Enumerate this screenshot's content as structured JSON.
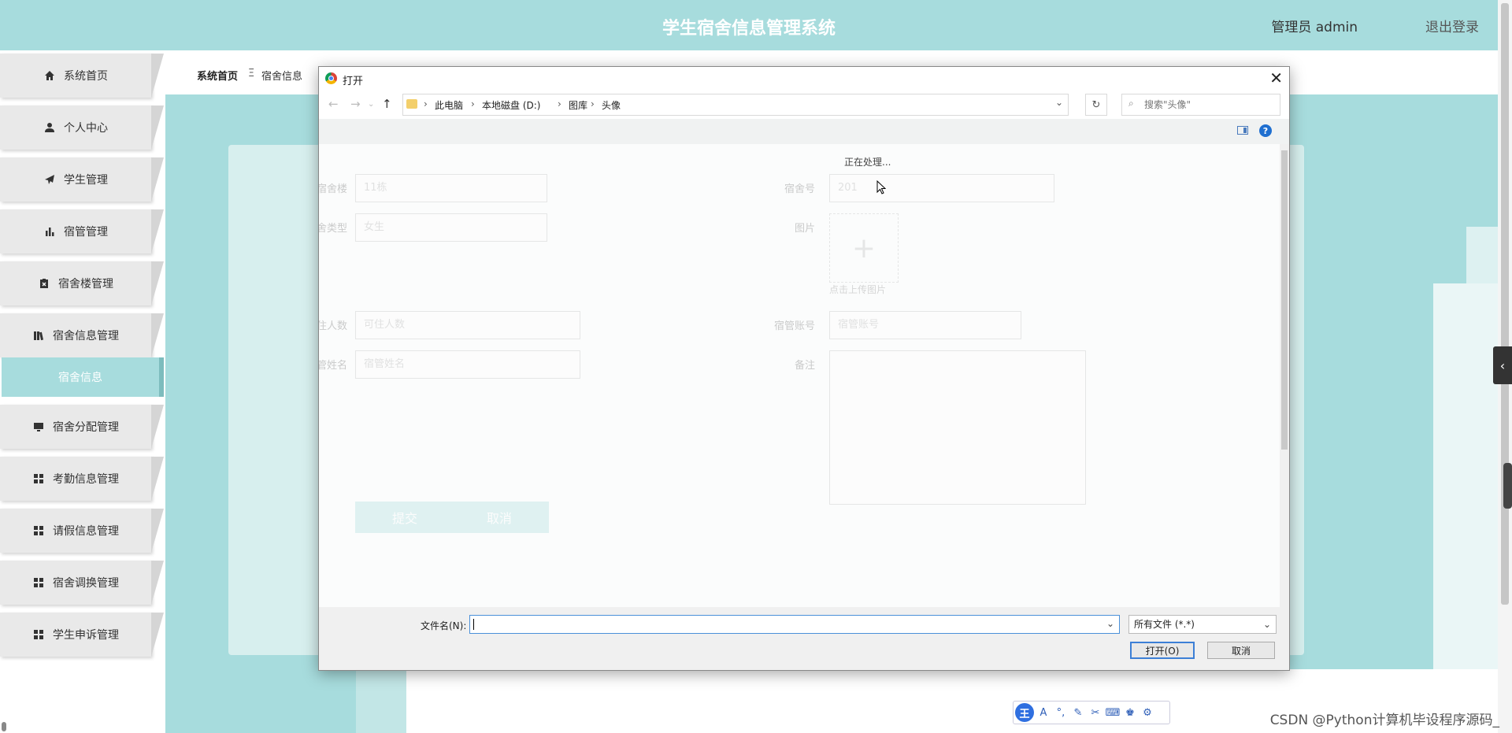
{
  "header": {
    "title": "学生宿舍信息管理系统",
    "user": "管理员 admin",
    "logout": "退出登录"
  },
  "breadcrumb": {
    "home": "系统首页",
    "separator": "Ξ",
    "current": "宿舍信息"
  },
  "sidebar": {
    "items": [
      {
        "label": "系统首页",
        "icon": "home-icon"
      },
      {
        "label": "个人中心",
        "icon": "user-icon"
      },
      {
        "label": "学生管理",
        "icon": "paper-plane-icon"
      },
      {
        "label": "宿管管理",
        "icon": "bar-chart-icon"
      },
      {
        "label": "宿舍楼管理",
        "icon": "clipboard-icon"
      },
      {
        "label": "宿舍信息管理",
        "icon": "books-icon"
      },
      {
        "label": "宿舍信息",
        "icon": ""
      },
      {
        "label": "宿舍分配管理",
        "icon": "monitor-icon"
      },
      {
        "label": "考勤信息管理",
        "icon": "grid-icon"
      },
      {
        "label": "请假信息管理",
        "icon": "grid-icon"
      },
      {
        "label": "宿舍调换管理",
        "icon": "grid-icon"
      },
      {
        "label": "学生申诉管理",
        "icon": "grid-icon"
      }
    ]
  },
  "form": {
    "building_label": "宿舍楼",
    "building_value": "11栋",
    "room_label": "宿舍号",
    "room_value": "201",
    "type_label": "宿舍类型",
    "type_value": "女生",
    "photo_label": "图片",
    "photo_hint": "点击上传图片",
    "capacity_label": "可住人数",
    "capacity_placeholder": "可住人数",
    "account_label": "宿管账号",
    "account_placeholder": "宿管账号",
    "manager_label": "宿管姓名",
    "manager_placeholder": "宿管姓名",
    "remark_label": "备注",
    "submit": "提交",
    "cancel": "取消"
  },
  "dialog": {
    "title": "打开",
    "close": "✕",
    "path": [
      "此电脑",
      "本地磁盘 (D:)",
      "图库",
      "头像"
    ],
    "search_placeholder": "搜索\"头像\"",
    "processing": "正在处理...",
    "filename_label": "文件名(N):",
    "filename_value": "",
    "filetype": "所有文件 (*.*)",
    "open_button": "打开(O)",
    "cancel_button": "取消"
  },
  "watermark": "CSDN @Python计算机毕设程序源码_",
  "ime": {
    "logo": "王"
  },
  "colors": {
    "accent": "#a7dcdd",
    "active": "#7dbcbd",
    "focus": "#3c7fd6"
  }
}
